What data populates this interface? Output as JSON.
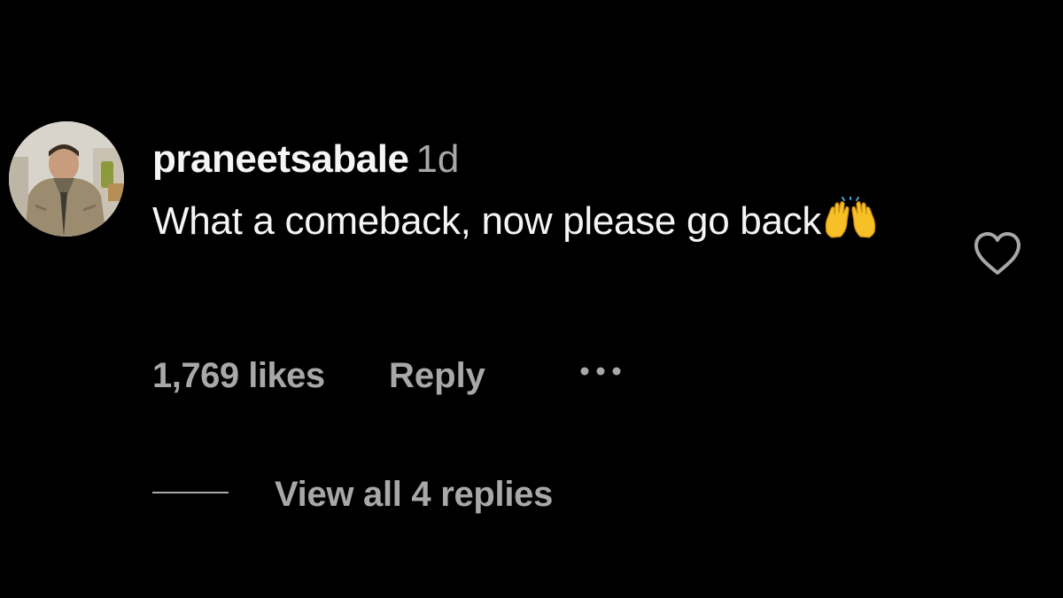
{
  "comment": {
    "username": "praneetsabale",
    "timestamp": "1d",
    "text": "What a comeback, now please go back",
    "emoji": "raising-hands-emoji",
    "likes": "1,769 likes",
    "reply_label": "Reply",
    "more_icon": "more-options-icon",
    "like_icon": "heart-icon",
    "view_replies_label": "View all 4 replies"
  },
  "colors": {
    "background": "#000000",
    "primary_text": "#f5f5f5",
    "secondary_text": "#a8a8a8",
    "emoji_yellow": "#f6c026"
  }
}
